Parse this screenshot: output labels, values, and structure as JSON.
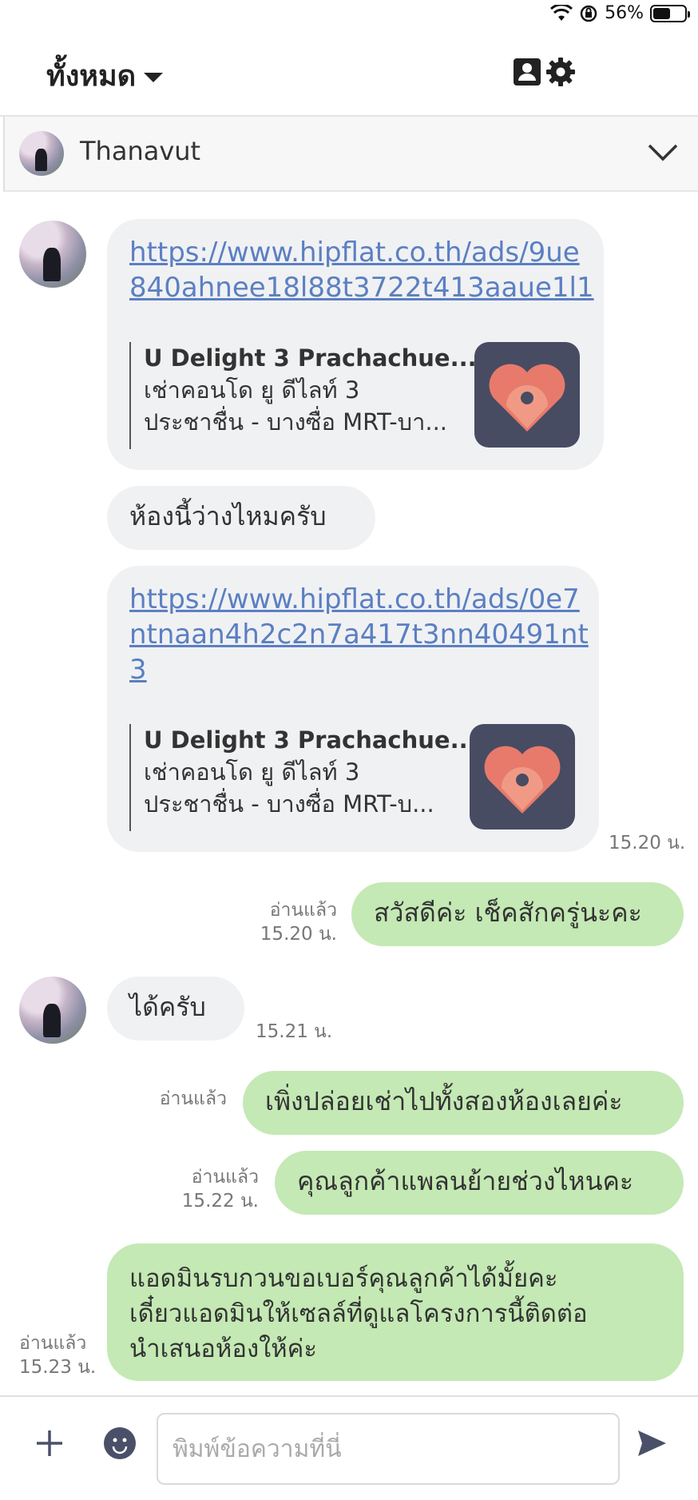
{
  "status": {
    "battery": "56%"
  },
  "header": {
    "title": "ทั้งหมด"
  },
  "chat": {
    "contact_name": "Thanavut"
  },
  "messages": {
    "m1": {
      "link": "https://www.hipflat.co.th/ads/9ue840ahnee18l88t3722t413aaue1l1",
      "link_line1": "https://www.hipflat.co.th/ads/9ue",
      "link_line2": "840ahnee18l88t3722t413aaue1l1",
      "preview_title": "U Delight 3 Prachachue...",
      "preview_desc1": "เช่าคอนโด ยู ดีไลท์ 3",
      "preview_desc2": "ประชาชื่น - บางซื่อ MRT-บา..."
    },
    "m2": {
      "text": "ห้องนี้ว่างไหมครับ"
    },
    "m3": {
      "link_line1": "https://www.hipflat.co.th/ads/0e7",
      "link_line2": "ntnaan4h2c2n7a417t3nn40491nt",
      "link_line3": "3",
      "preview_title": "U Delight 3 Prachachue...",
      "preview_desc1": "เช่าคอนโด ยู ดีไลท์ 3",
      "preview_desc2": "ประชาชื่น - บางซื่อ MRT-บ...",
      "time": "15.20 น."
    },
    "m4": {
      "text": "สวัสดีค่ะ เช็คสักครู่นะคะ",
      "read": "อ่านแล้ว",
      "time": "15.20 น."
    },
    "m5": {
      "text": "ได้ครับ",
      "time": "15.21 น."
    },
    "m6": {
      "text": "เพิ่งปล่อยเช่าไปทั้งสองห้องเลยค่ะ",
      "read": "อ่านแล้ว"
    },
    "m7": {
      "text": "คุณลูกค้าแพลนย้ายช่วงไหนคะ",
      "read": "อ่านแล้ว",
      "time": "15.22 น."
    },
    "m8": {
      "line1": "แอดมินรบกวนขอเบอร์คุณลูกค้าได้มั้ยคะ",
      "line2": "เดี๋ยวแอดมินให้เซลล์ที่ดูแลโครงการนี้ติดต่อ",
      "line3": "นำเสนอห้องให้ค่ะ",
      "read": "อ่านแล้ว",
      "time": "15.23 น."
    }
  },
  "composer": {
    "placeholder": "พิมพ์ข้อความที่นี่"
  },
  "colors": {
    "outgoing_bubble": "#c4e9b4",
    "incoming_bubble": "#f0f1f3",
    "link": "#5b7fc2"
  }
}
